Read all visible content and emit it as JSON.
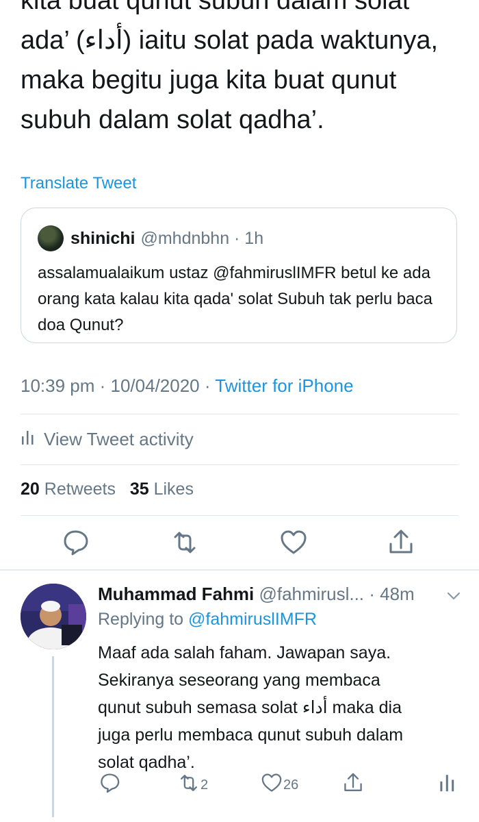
{
  "tweet": {
    "body_lines": [
      "kita buat qunut subuh dalam solat",
      "ada’ (أداء) iaitu solat pada waktunya,",
      "maka begitu juga kita buat qunut",
      "subuh dalam solat qadha’."
    ],
    "translate_label": "Translate Tweet",
    "quoted": {
      "name": "shinichi",
      "handle_time": "@mhdnbhn · 1h",
      "text": "assalamualaikum ustaz @fahmiruslIMFR betul ke ada orang kata kalau kita qada' solat Subuh tak perlu baca doa Qunut?"
    },
    "timestamp": "10:39 pm · 10/04/2020 · ",
    "source": "Twitter for iPhone",
    "activity_label": "View Tweet activity",
    "retweets_count": "20",
    "retweets_label": " Retweets",
    "likes_count": "35",
    "likes_label": " Likes",
    "action_icons": [
      "reply-icon",
      "retweet-icon",
      "like-icon",
      "share-icon"
    ]
  },
  "reply": {
    "name": "Muhammad Fahmi",
    "handle_time": " @fahmirusl... · 48m",
    "replying_prefix": "Replying to ",
    "replying_to": "@fahmiruslIMFR",
    "text_lines": [
      "Maaf ada salah faham. Jawapan saya.",
      "Sekiranya seseorang yang membaca",
      "qunut subuh semasa solat أداء maka dia",
      "juga perlu membaca qunut subuh dalam",
      "solat qadha’."
    ],
    "retweet_count": "2",
    "like_count": "26"
  },
  "colors": {
    "link_blue": "#1b95e0",
    "secondary_gray": "#657786",
    "text_dark": "#14171a",
    "border": "#ccd6dd"
  }
}
